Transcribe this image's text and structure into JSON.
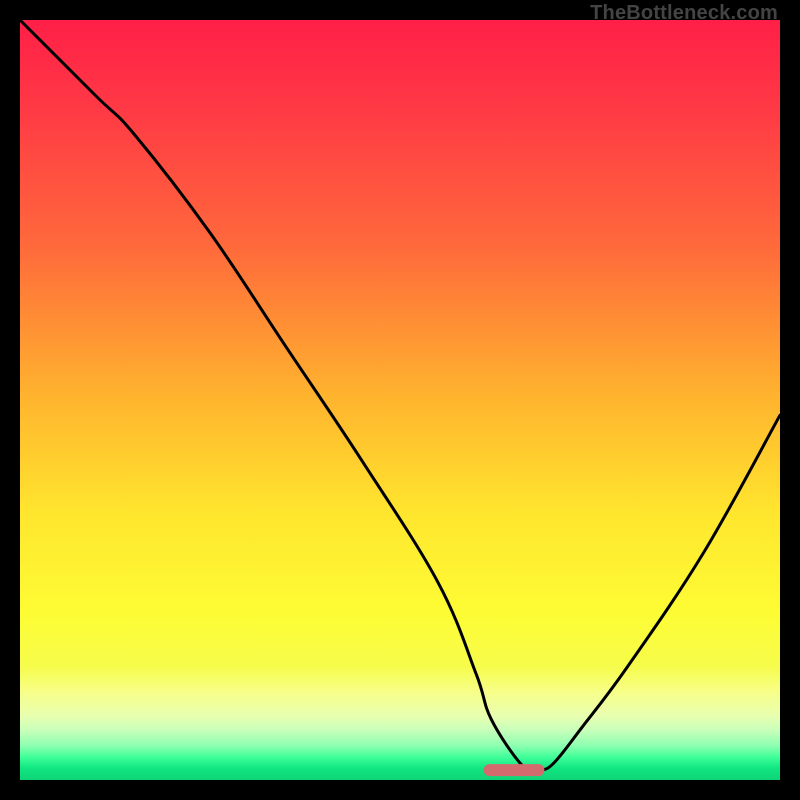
{
  "watermark": "TheBottleneck.com",
  "chart_data": {
    "type": "line",
    "title": "",
    "xlabel": "",
    "ylabel": "",
    "xlim": [
      0,
      100
    ],
    "ylim": [
      0,
      100
    ],
    "series": [
      {
        "name": "bottleneck-curve",
        "x": [
          0,
          10,
          15,
          25,
          35,
          45,
          55,
          60,
          62,
          66,
          68,
          70,
          74,
          80,
          90,
          100
        ],
        "values": [
          100,
          90,
          85,
          72,
          57,
          42,
          26,
          14,
          8,
          2,
          1.5,
          2,
          7,
          15,
          30,
          48
        ]
      }
    ],
    "optimal_marker": {
      "x_start": 61,
      "x_end": 69,
      "y": 1.3,
      "color": "#d36b6e"
    },
    "gradient_stops": [
      {
        "offset": 0.0,
        "color": "#ff1f47"
      },
      {
        "offset": 0.12,
        "color": "#ff3a45"
      },
      {
        "offset": 0.3,
        "color": "#ff6a3b"
      },
      {
        "offset": 0.5,
        "color": "#ffb52e"
      },
      {
        "offset": 0.65,
        "color": "#ffe62e"
      },
      {
        "offset": 0.78,
        "color": "#fdfc34"
      },
      {
        "offset": 0.85,
        "color": "#f6fc4a"
      },
      {
        "offset": 0.885,
        "color": "#f7ff8a"
      },
      {
        "offset": 0.915,
        "color": "#e9ffb0"
      },
      {
        "offset": 0.935,
        "color": "#c7ffba"
      },
      {
        "offset": 0.955,
        "color": "#8dffb0"
      },
      {
        "offset": 0.97,
        "color": "#3eff99"
      },
      {
        "offset": 0.985,
        "color": "#10e580"
      },
      {
        "offset": 1.0,
        "color": "#0fd477"
      }
    ]
  }
}
